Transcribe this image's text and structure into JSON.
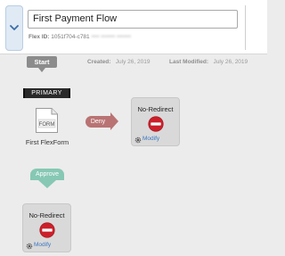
{
  "header": {
    "flow_title": "First Payment Flow",
    "flex_id_label": "Flex ID:",
    "flex_id_value": "1051f704-c781",
    "flex_id_obscured": "•••• ••••••• •••••••"
  },
  "canvas": {
    "start_label": "Start",
    "created_label": "Created:",
    "created_date": "July 26, 2019",
    "modified_label": "Last Modified:",
    "modified_date": "July 26, 2019",
    "primary_tag": "PRIMARY",
    "form_icon_text": "FORM",
    "form_name": "First FlexForm",
    "deny_label": "Deny",
    "approve_label": "Approve",
    "redirect_nodes": [
      {
        "title": "No-Redirect",
        "action": "Modify"
      },
      {
        "title": "No-Redirect",
        "action": "Modify"
      }
    ]
  },
  "colors": {
    "deny": "#b97373",
    "approve": "#86c8b4",
    "stop": "#cc1f2a",
    "link": "#3b77c2"
  }
}
